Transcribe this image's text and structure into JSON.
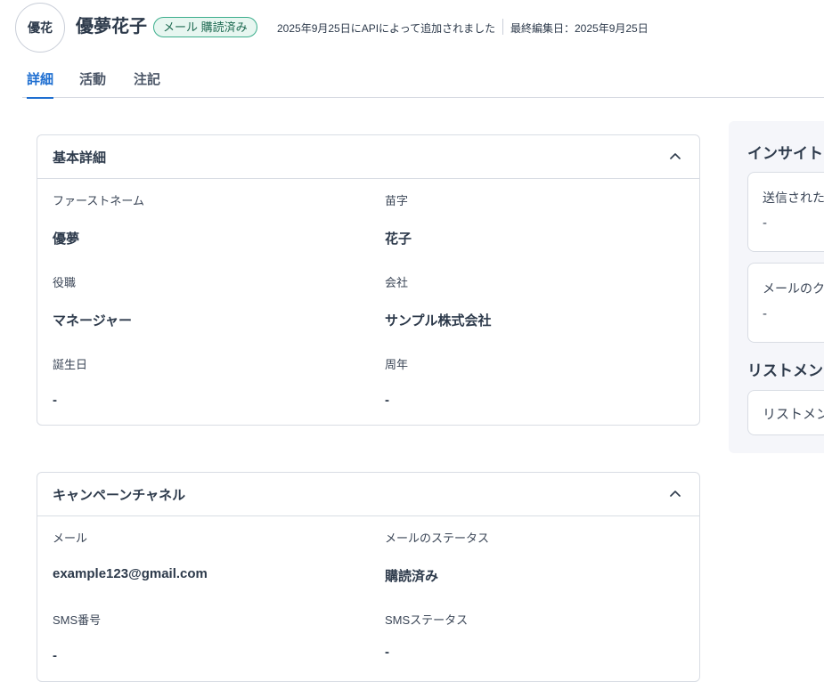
{
  "contact": {
    "avatar_initials": "優花",
    "name": "優夢花子",
    "status_badge": "メール 購読済み",
    "added_text": "2025年9月25日にAPIによって追加されました",
    "edited_text": "最終編集日：2025年9月25日"
  },
  "tabs": [
    {
      "label": "詳細",
      "active": true
    },
    {
      "label": "活動",
      "active": false
    },
    {
      "label": "注記",
      "active": false
    }
  ],
  "basic_details": {
    "title": "基本詳細",
    "fields": [
      {
        "label": "ファーストネーム",
        "value": "優夢"
      },
      {
        "label": "苗字",
        "value": "花子"
      },
      {
        "label": "役職",
        "value": "マネージャー"
      },
      {
        "label": "会社",
        "value": "サンプル株式会社"
      },
      {
        "label": "誕生日",
        "value": "-"
      },
      {
        "label": "周年",
        "value": "-"
      }
    ]
  },
  "campaign_channels": {
    "title": "キャンペーンチャネル",
    "fields": [
      {
        "label": "メール",
        "value": "example123@gmail.com"
      },
      {
        "label": "メールのステータス",
        "value": "購読済み"
      },
      {
        "label": "SMS番号",
        "value": "-"
      },
      {
        "label": "SMSステータス",
        "value": "-"
      }
    ]
  },
  "insights": {
    "title": "インサイト",
    "cards": [
      {
        "label": "送信された",
        "value": "-"
      },
      {
        "label": "メールのク",
        "value": "-"
      }
    ]
  },
  "list_membership": {
    "title": "リストメン",
    "card_label": "リストメン"
  },
  "colors": {
    "accent": "#1f6fd1",
    "badge_border": "#3cae8c",
    "badge_bg": "#e7f6f0",
    "panel_bg": "#f5f6fa",
    "text": "#2d3a4b"
  },
  "icons": {
    "collapse": "chevron-up-icon"
  }
}
